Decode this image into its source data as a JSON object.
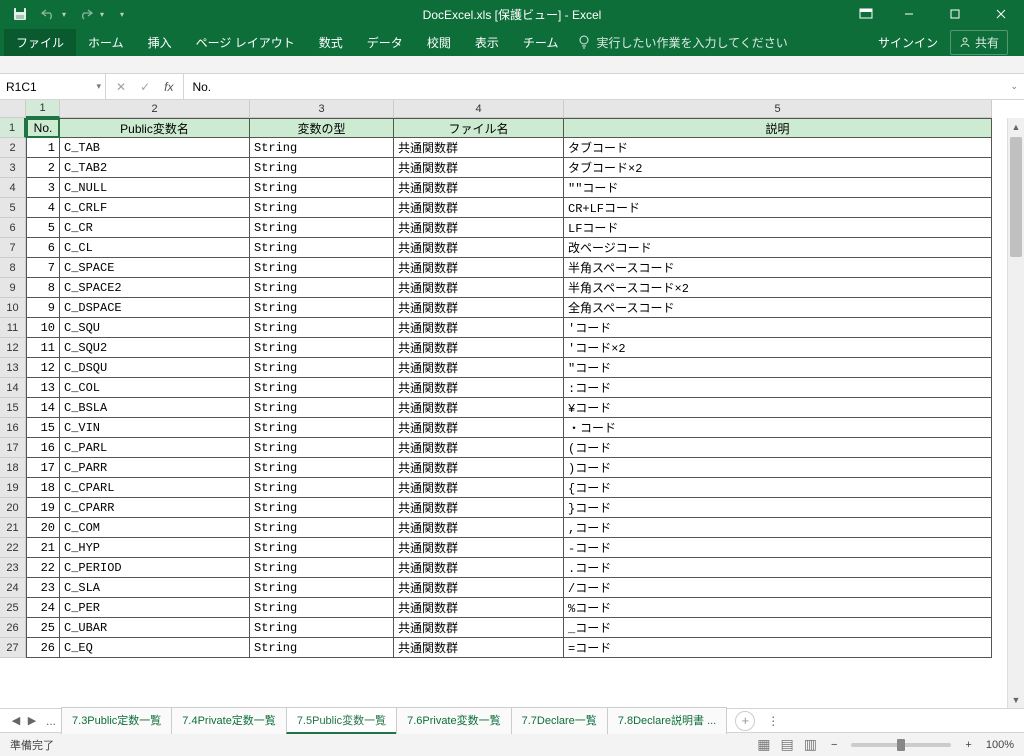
{
  "title": "DocExcel.xls  [保護ビュー] - Excel",
  "qat": {
    "save": "💾"
  },
  "ribbon": {
    "tabs": [
      "ファイル",
      "ホーム",
      "挿入",
      "ページ レイアウト",
      "数式",
      "データ",
      "校閲",
      "表示",
      "チーム"
    ],
    "tell_me": "実行したい作業を入力してください",
    "signin": "サインイン",
    "share": "共有"
  },
  "name_box": "R1C1",
  "formula": "No.",
  "columns": [
    "1",
    "2",
    "3",
    "4",
    "5"
  ],
  "col_widths": [
    "w-no",
    "w-name",
    "w-type",
    "w-file",
    "w-desc"
  ],
  "header_row": [
    "No.",
    "Public変数名",
    "変数の型",
    "ファイル名",
    "説明"
  ],
  "rows": [
    {
      "no": "1",
      "name": "C_TAB",
      "type": "String",
      "file": "共通関数群",
      "desc": "タブコード"
    },
    {
      "no": "2",
      "name": "C_TAB2",
      "type": "String",
      "file": "共通関数群",
      "desc": "タブコード×2"
    },
    {
      "no": "3",
      "name": "C_NULL",
      "type": "String",
      "file": "共通関数群",
      "desc": "\"\"コード"
    },
    {
      "no": "4",
      "name": "C_CRLF",
      "type": "String",
      "file": "共通関数群",
      "desc": "CR+LFコード"
    },
    {
      "no": "5",
      "name": "C_CR",
      "type": "String",
      "file": "共通関数群",
      "desc": "LFコード"
    },
    {
      "no": "6",
      "name": "C_CL",
      "type": "String",
      "file": "共通関数群",
      "desc": "改ページコード"
    },
    {
      "no": "7",
      "name": "C_SPACE",
      "type": "String",
      "file": "共通関数群",
      "desc": "半角スペースコード"
    },
    {
      "no": "8",
      "name": "C_SPACE2",
      "type": "String",
      "file": "共通関数群",
      "desc": "半角スペースコード×2"
    },
    {
      "no": "9",
      "name": "C_DSPACE",
      "type": "String",
      "file": "共通関数群",
      "desc": "全角スペースコード"
    },
    {
      "no": "10",
      "name": "C_SQU",
      "type": "String",
      "file": "共通関数群",
      "desc": "'コード"
    },
    {
      "no": "11",
      "name": "C_SQU2",
      "type": "String",
      "file": "共通関数群",
      "desc": "'コード×2"
    },
    {
      "no": "12",
      "name": "C_DSQU",
      "type": "String",
      "file": "共通関数群",
      "desc": "\"コード"
    },
    {
      "no": "13",
      "name": "C_COL",
      "type": "String",
      "file": "共通関数群",
      "desc": ":コード"
    },
    {
      "no": "14",
      "name": "C_BSLA",
      "type": "String",
      "file": "共通関数群",
      "desc": "¥コード"
    },
    {
      "no": "15",
      "name": "C_VIN",
      "type": "String",
      "file": "共通関数群",
      "desc": "・コード"
    },
    {
      "no": "16",
      "name": "C_PARL",
      "type": "String",
      "file": "共通関数群",
      "desc": "(コード"
    },
    {
      "no": "17",
      "name": "C_PARR",
      "type": "String",
      "file": "共通関数群",
      "desc": ")コード"
    },
    {
      "no": "18",
      "name": "C_CPARL",
      "type": "String",
      "file": "共通関数群",
      "desc": "{コード"
    },
    {
      "no": "19",
      "name": "C_CPARR",
      "type": "String",
      "file": "共通関数群",
      "desc": "}コード"
    },
    {
      "no": "20",
      "name": "C_COM",
      "type": "String",
      "file": "共通関数群",
      "desc": ",コード"
    },
    {
      "no": "21",
      "name": "C_HYP",
      "type": "String",
      "file": "共通関数群",
      "desc": " -コード"
    },
    {
      "no": "22",
      "name": "C_PERIOD",
      "type": "String",
      "file": "共通関数群",
      "desc": ".コード"
    },
    {
      "no": "23",
      "name": "C_SLA",
      "type": "String",
      "file": "共通関数群",
      "desc": "/コード"
    },
    {
      "no": "24",
      "name": "C_PER",
      "type": "String",
      "file": "共通関数群",
      "desc": "%コード"
    },
    {
      "no": "25",
      "name": "C_UBAR",
      "type": "String",
      "file": "共通関数群",
      "desc": "_コード"
    },
    {
      "no": "26",
      "name": "C_EQ",
      "type": "String",
      "file": "共通関数群",
      "desc": " =コード"
    }
  ],
  "sheet_tabs": {
    "tabs": [
      "7.3Public定数一覧",
      "7.4Private定数一覧",
      "7.5Public変数一覧",
      "7.6Private変数一覧",
      "7.7Declare一覧",
      "7.8Declare説明書 ..."
    ],
    "active_index": 2
  },
  "status": {
    "ready": "準備完了",
    "zoom": "100%"
  }
}
